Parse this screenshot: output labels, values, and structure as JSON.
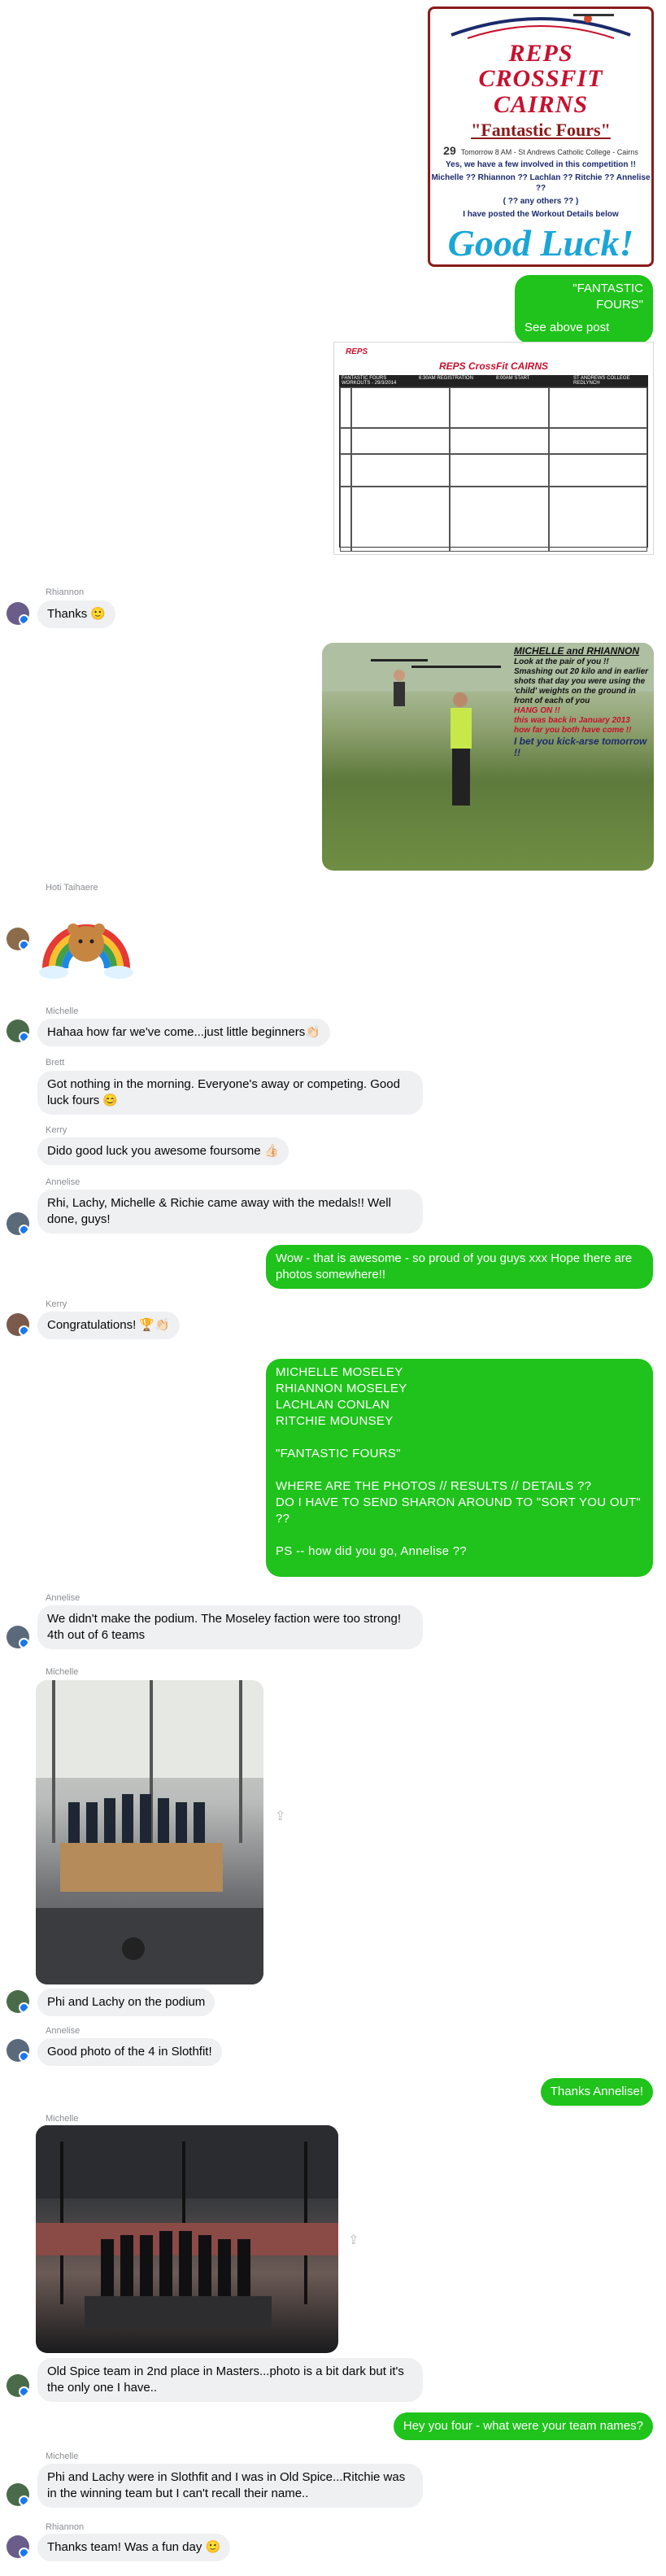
{
  "poster": {
    "brand_line1": "REPS",
    "brand_line2": "CROSSFIT CAIRNS",
    "event": "\"Fantastic Fours\"",
    "date_day": "29",
    "date_text": "Tomorrow 8 AM - St Andrews Catholic College - Cairns",
    "line1": "Yes, we have a few involved in this competition !!",
    "line2": "Michelle ?? Rhiannon ?? Lachlan ?? Ritchie ?? Annelise ??",
    "line3": "( ?? any others ?? )",
    "line4": "I have posted the Workout Details below",
    "good_luck": "Good Luck!"
  },
  "doc": {
    "title": "REPS CrossFit CAIRNS",
    "headers": [
      "FANTASTIC FOURS WORKOUTS - 29/3/2014",
      "6:30AM REGISTRATION",
      "8:00AM START",
      "ST ANDREWS COLLEGE REDLYNCH"
    ]
  },
  "messages": [
    {
      "id": "m1",
      "dir": "out",
      "lines": [
        "\"FANTASTIC FOURS\"",
        "",
        "See above post"
      ]
    },
    {
      "id": "m2",
      "dir": "in",
      "sender": "Rhiannon",
      "text": "Thanks 🙂"
    },
    {
      "id": "m3",
      "dir": "out",
      "kind": "photo",
      "caption_title": "MICHELLE and RHIANNON",
      "caption_lines": [
        "Look at the pair of you !!",
        "Smashing out 20 kilo and in earlier shots that day you were using the 'child' weights on the ground in front of each of you",
        "HANG ON !!",
        "this was back in January 2013",
        "how far you both have come !!",
        "I bet you kick-arse tomorrow !!"
      ]
    },
    {
      "id": "m4",
      "dir": "in",
      "sender": "Hoti Taihaere",
      "kind": "sticker"
    },
    {
      "id": "m5",
      "dir": "in",
      "sender": "Michelle",
      "text": "Hahaa how far we've come...just little beginners👏🏻"
    },
    {
      "id": "m6",
      "dir": "in",
      "sender": "Brett",
      "text": "Got nothing in the morning. Everyone's away or competing. Good luck fours 😊"
    },
    {
      "id": "m7",
      "dir": "in",
      "sender": "Kerry",
      "text": "Dido good luck you awesome foursome 👍🏻"
    },
    {
      "id": "m8",
      "dir": "in",
      "sender": "Annelise",
      "text": "Rhi, Lachy, Michelle & Richie came away with the medals!! Well done, guys!"
    },
    {
      "id": "m9",
      "dir": "out",
      "text": "Wow - that is awesome - so proud of you guys xxx Hope there are photos somewhere!!"
    },
    {
      "id": "m10",
      "dir": "in",
      "sender": "Kerry",
      "text": "Congratulations! 🏆👏🏻"
    },
    {
      "id": "m11",
      "dir": "out",
      "lines": [
        "MICHELLE  MOSELEY",
        "RHIANNON  MOSELEY",
        "LACHLAN  CONLAN",
        "RITCHIE  MOUNSEY",
        "",
        "\"FANTASTIC  FOURS\"",
        "",
        "WHERE  ARE  THE  PHOTOS  //  RESULTS  //  DETAILS  ??",
        "DO  I  HAVE  TO  SEND  SHARON  AROUND  TO  \"SORT  YOU  OUT\"  ??",
        "",
        "PS -- how did you go, Annelise ??"
      ]
    },
    {
      "id": "m12",
      "dir": "in",
      "sender": "Annelise",
      "text": "We didn't make the podium. The Moseley faction were too strong! 4th out of 6 teams"
    },
    {
      "id": "m13",
      "dir": "in",
      "sender": "Michelle",
      "kind": "photo"
    },
    {
      "id": "m14",
      "dir": "in",
      "text": "Phi and Lachy on the podium"
    },
    {
      "id": "m15",
      "dir": "in",
      "sender": "Annelise",
      "text": "Good photo of the 4 in Slothfit!"
    },
    {
      "id": "m16",
      "dir": "out",
      "text": "Thanks Annelise!"
    },
    {
      "id": "m17",
      "dir": "in",
      "sender": "Michelle",
      "kind": "photo"
    },
    {
      "id": "m18",
      "dir": "in",
      "text": "Old Spice team in 2nd place in Masters...photo is a bit dark but it's the only one I have.."
    },
    {
      "id": "m19",
      "dir": "out",
      "text": "Hey you four - what were your team names?"
    },
    {
      "id": "m20",
      "dir": "in",
      "sender": "Michelle",
      "text": "Phi and Lachy were in Slothfit and I was in Old Spice...Ritchie was in the winning team but I can't recall their name.."
    },
    {
      "id": "m21",
      "dir": "in",
      "sender": "Rhiannon",
      "text": "Thanks team! Was a fun day 🙂"
    }
  ],
  "icons": {
    "share": "share-icon",
    "avatar_badge": "messenger-badge-icon"
  },
  "colors": {
    "outgoing": "#1fc31b",
    "incoming": "#eff0f2",
    "sender_label": "#8a8d91",
    "poster_red": "#c8102e",
    "poster_blue": "#1aa6d8"
  }
}
